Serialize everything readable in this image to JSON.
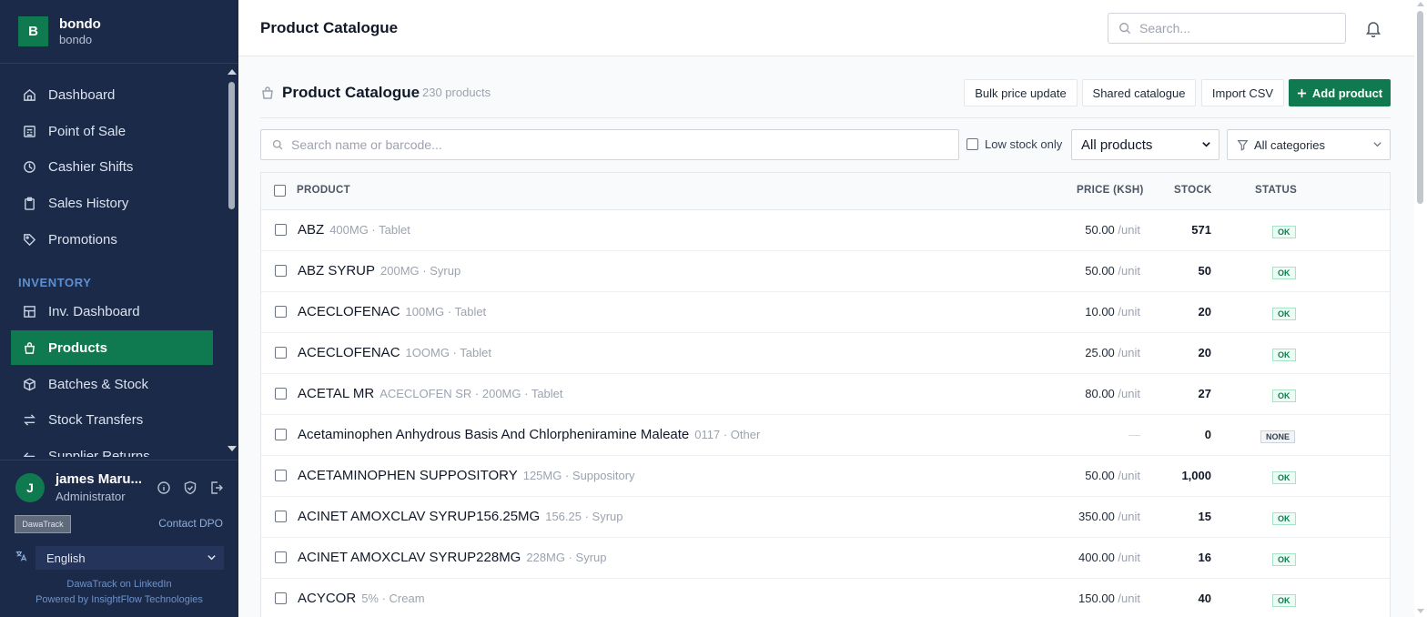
{
  "brand": {
    "initial": "B",
    "name": "bondo",
    "sub": "bondo"
  },
  "nav": {
    "items": [
      {
        "label": "Dashboard",
        "icon": "home-icon"
      },
      {
        "label": "Point of Sale",
        "icon": "register-icon"
      },
      {
        "label": "Cashier Shifts",
        "icon": "clock-icon"
      },
      {
        "label": "Sales History",
        "icon": "clipboard-icon"
      },
      {
        "label": "Promotions",
        "icon": "tag-icon"
      }
    ],
    "section_inventory": "INVENTORY",
    "inventory_items": [
      {
        "label": "Inv. Dashboard",
        "icon": "dashboard-icon"
      },
      {
        "label": "Products",
        "icon": "bag-icon",
        "active": true
      },
      {
        "label": "Batches & Stock",
        "icon": "box-icon"
      },
      {
        "label": "Stock Transfers",
        "icon": "transfer-icon"
      },
      {
        "label": "Supplier Returns",
        "icon": "return-icon"
      }
    ]
  },
  "user": {
    "initial": "J",
    "name": "james Maru...",
    "role": "Administrator",
    "logo_text": "DawaTrack",
    "contact": "Contact DPO",
    "language": "English"
  },
  "footer": {
    "linkedin": "DawaTrack on LinkedIn",
    "powered": "Powered by InsightFlow Technologies"
  },
  "topbar": {
    "title": "Product Catalogue",
    "search_placeholder": "Search..."
  },
  "catalogue": {
    "title": "Product Catalogue",
    "count": "230 products",
    "buttons": {
      "bulk": "Bulk price update",
      "shared": "Shared catalogue",
      "import": "Import CSV",
      "add": "Add product"
    },
    "search_placeholder": "Search name or barcode...",
    "low_stock_label": "Low stock only",
    "filter_products": "All products",
    "filter_categories": "All categories"
  },
  "table": {
    "headers": {
      "product": "PRODUCT",
      "price": "PRICE (KSH)",
      "stock": "STOCK",
      "status": "STATUS"
    },
    "rows": [
      {
        "name": "ABZ",
        "meta": "400MG · Tablet",
        "price": "50.00",
        "unit": "/unit",
        "stock": "571",
        "status": "OK"
      },
      {
        "name": "ABZ SYRUP",
        "meta": "200MG · Syrup",
        "price": "50.00",
        "unit": "/unit",
        "stock": "50",
        "status": "OK"
      },
      {
        "name": "ACECLOFENAC",
        "meta": "100MG · Tablet",
        "price": "10.00",
        "unit": "/unit",
        "stock": "20",
        "status": "OK"
      },
      {
        "name": "ACECLOFENAC",
        "meta": "1OOMG · Tablet",
        "price": "25.00",
        "unit": "/unit",
        "stock": "20",
        "status": "OK"
      },
      {
        "name": "ACETAL MR",
        "meta": "ACECLOFEN SR · 200MG · Tablet",
        "price": "80.00",
        "unit": "/unit",
        "stock": "27",
        "status": "OK"
      },
      {
        "name": "Acetaminophen Anhydrous Basis And Chlorpheniramine Maleate",
        "meta": "0117 · Other",
        "price": "—",
        "unit": "",
        "stock": "0",
        "status": "NONE"
      },
      {
        "name": "ACETAMINOPHEN SUPPOSITORY",
        "meta": "125MG · Suppository",
        "price": "50.00",
        "unit": "/unit",
        "stock": "1,000",
        "status": "OK"
      },
      {
        "name": "ACINET AMOXCLAV SYRUP156.25MG",
        "meta": "156.25 · Syrup",
        "price": "350.00",
        "unit": "/unit",
        "stock": "15",
        "status": "OK"
      },
      {
        "name": "ACINET AMOXCLAV SYRUP228MG",
        "meta": "228MG · Syrup",
        "price": "400.00",
        "unit": "/unit",
        "stock": "16",
        "status": "OK"
      },
      {
        "name": "ACYCOR",
        "meta": "5% · Cream",
        "price": "150.00",
        "unit": "/unit",
        "stock": "40",
        "status": "OK"
      }
    ]
  },
  "colors": {
    "sidebar": "#1b2a49",
    "accent": "#0f7a4f",
    "section": "#5f8fd0"
  }
}
